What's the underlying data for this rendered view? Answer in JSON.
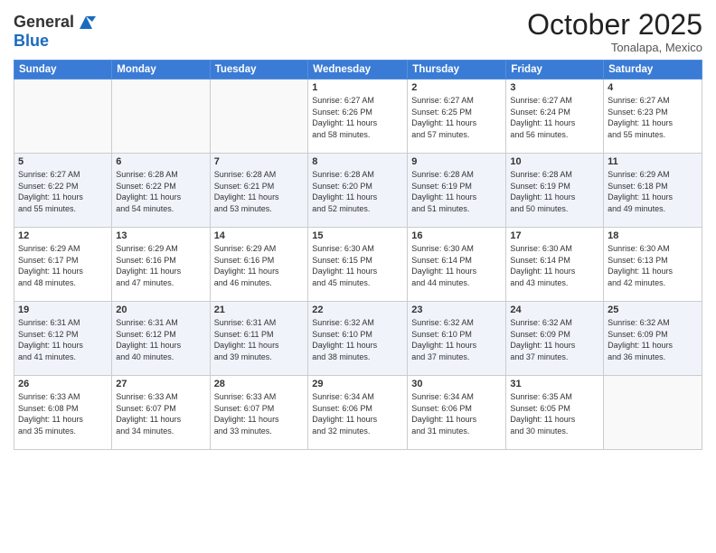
{
  "logo": {
    "general": "General",
    "blue": "Blue"
  },
  "header": {
    "month": "October 2025",
    "location": "Tonalapa, Mexico"
  },
  "weekdays": [
    "Sunday",
    "Monday",
    "Tuesday",
    "Wednesday",
    "Thursday",
    "Friday",
    "Saturday"
  ],
  "weeks": [
    [
      {
        "day": "",
        "info": ""
      },
      {
        "day": "",
        "info": ""
      },
      {
        "day": "",
        "info": ""
      },
      {
        "day": "1",
        "info": "Sunrise: 6:27 AM\nSunset: 6:26 PM\nDaylight: 11 hours\nand 58 minutes."
      },
      {
        "day": "2",
        "info": "Sunrise: 6:27 AM\nSunset: 6:25 PM\nDaylight: 11 hours\nand 57 minutes."
      },
      {
        "day": "3",
        "info": "Sunrise: 6:27 AM\nSunset: 6:24 PM\nDaylight: 11 hours\nand 56 minutes."
      },
      {
        "day": "4",
        "info": "Sunrise: 6:27 AM\nSunset: 6:23 PM\nDaylight: 11 hours\nand 55 minutes."
      }
    ],
    [
      {
        "day": "5",
        "info": "Sunrise: 6:27 AM\nSunset: 6:22 PM\nDaylight: 11 hours\nand 55 minutes."
      },
      {
        "day": "6",
        "info": "Sunrise: 6:28 AM\nSunset: 6:22 PM\nDaylight: 11 hours\nand 54 minutes."
      },
      {
        "day": "7",
        "info": "Sunrise: 6:28 AM\nSunset: 6:21 PM\nDaylight: 11 hours\nand 53 minutes."
      },
      {
        "day": "8",
        "info": "Sunrise: 6:28 AM\nSunset: 6:20 PM\nDaylight: 11 hours\nand 52 minutes."
      },
      {
        "day": "9",
        "info": "Sunrise: 6:28 AM\nSunset: 6:19 PM\nDaylight: 11 hours\nand 51 minutes."
      },
      {
        "day": "10",
        "info": "Sunrise: 6:28 AM\nSunset: 6:19 PM\nDaylight: 11 hours\nand 50 minutes."
      },
      {
        "day": "11",
        "info": "Sunrise: 6:29 AM\nSunset: 6:18 PM\nDaylight: 11 hours\nand 49 minutes."
      }
    ],
    [
      {
        "day": "12",
        "info": "Sunrise: 6:29 AM\nSunset: 6:17 PM\nDaylight: 11 hours\nand 48 minutes."
      },
      {
        "day": "13",
        "info": "Sunrise: 6:29 AM\nSunset: 6:16 PM\nDaylight: 11 hours\nand 47 minutes."
      },
      {
        "day": "14",
        "info": "Sunrise: 6:29 AM\nSunset: 6:16 PM\nDaylight: 11 hours\nand 46 minutes."
      },
      {
        "day": "15",
        "info": "Sunrise: 6:30 AM\nSunset: 6:15 PM\nDaylight: 11 hours\nand 45 minutes."
      },
      {
        "day": "16",
        "info": "Sunrise: 6:30 AM\nSunset: 6:14 PM\nDaylight: 11 hours\nand 44 minutes."
      },
      {
        "day": "17",
        "info": "Sunrise: 6:30 AM\nSunset: 6:14 PM\nDaylight: 11 hours\nand 43 minutes."
      },
      {
        "day": "18",
        "info": "Sunrise: 6:30 AM\nSunset: 6:13 PM\nDaylight: 11 hours\nand 42 minutes."
      }
    ],
    [
      {
        "day": "19",
        "info": "Sunrise: 6:31 AM\nSunset: 6:12 PM\nDaylight: 11 hours\nand 41 minutes."
      },
      {
        "day": "20",
        "info": "Sunrise: 6:31 AM\nSunset: 6:12 PM\nDaylight: 11 hours\nand 40 minutes."
      },
      {
        "day": "21",
        "info": "Sunrise: 6:31 AM\nSunset: 6:11 PM\nDaylight: 11 hours\nand 39 minutes."
      },
      {
        "day": "22",
        "info": "Sunrise: 6:32 AM\nSunset: 6:10 PM\nDaylight: 11 hours\nand 38 minutes."
      },
      {
        "day": "23",
        "info": "Sunrise: 6:32 AM\nSunset: 6:10 PM\nDaylight: 11 hours\nand 37 minutes."
      },
      {
        "day": "24",
        "info": "Sunrise: 6:32 AM\nSunset: 6:09 PM\nDaylight: 11 hours\nand 37 minutes."
      },
      {
        "day": "25",
        "info": "Sunrise: 6:32 AM\nSunset: 6:09 PM\nDaylight: 11 hours\nand 36 minutes."
      }
    ],
    [
      {
        "day": "26",
        "info": "Sunrise: 6:33 AM\nSunset: 6:08 PM\nDaylight: 11 hours\nand 35 minutes."
      },
      {
        "day": "27",
        "info": "Sunrise: 6:33 AM\nSunset: 6:07 PM\nDaylight: 11 hours\nand 34 minutes."
      },
      {
        "day": "28",
        "info": "Sunrise: 6:33 AM\nSunset: 6:07 PM\nDaylight: 11 hours\nand 33 minutes."
      },
      {
        "day": "29",
        "info": "Sunrise: 6:34 AM\nSunset: 6:06 PM\nDaylight: 11 hours\nand 32 minutes."
      },
      {
        "day": "30",
        "info": "Sunrise: 6:34 AM\nSunset: 6:06 PM\nDaylight: 11 hours\nand 31 minutes."
      },
      {
        "day": "31",
        "info": "Sunrise: 6:35 AM\nSunset: 6:05 PM\nDaylight: 11 hours\nand 30 minutes."
      },
      {
        "day": "",
        "info": ""
      }
    ]
  ]
}
